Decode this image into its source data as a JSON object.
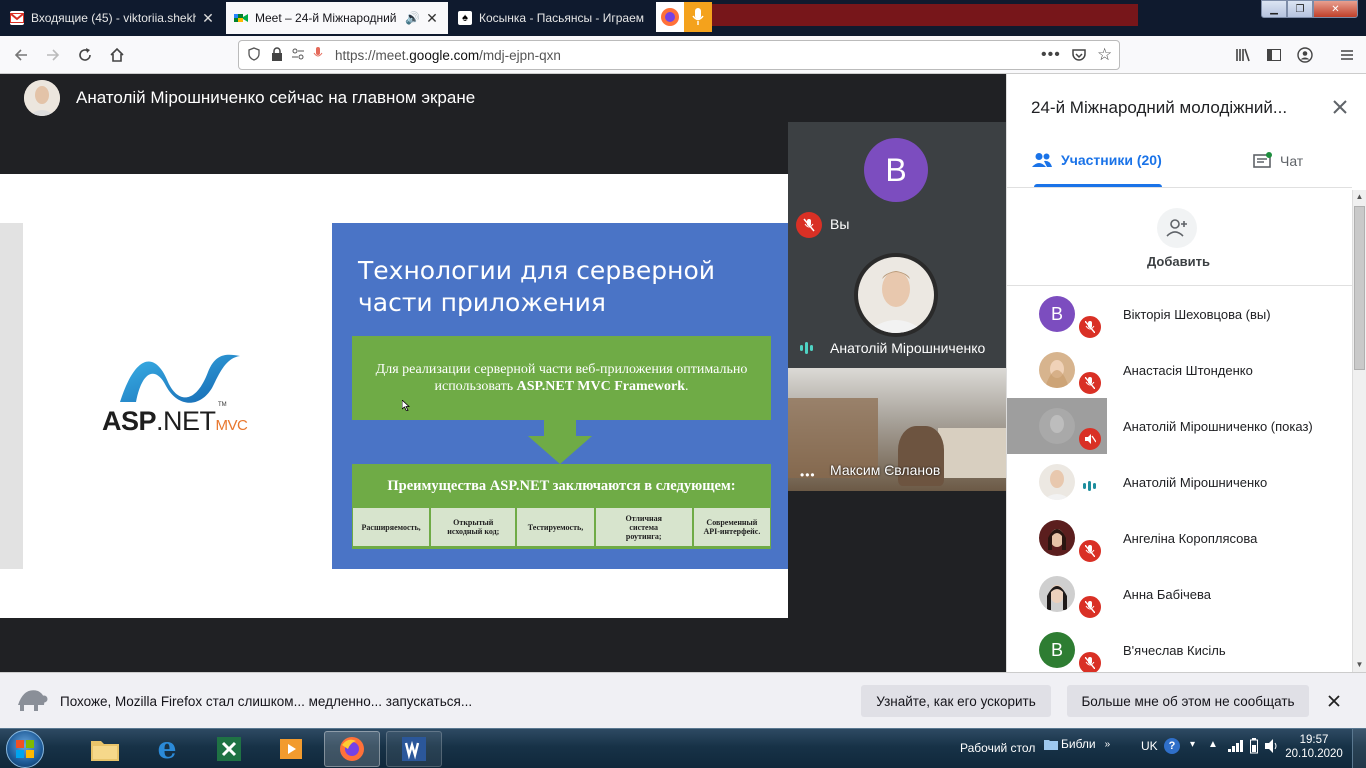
{
  "browser": {
    "tabs": [
      {
        "title": "Входящие (45) - viktoriia.shekh",
        "active": false,
        "favicon": "gmail-icon"
      },
      {
        "title": "Meet – 24-й Міжнародний",
        "active": true,
        "favicon": "meet-icon"
      },
      {
        "title": "Косынка - Пасьянсы - Играем",
        "active": false,
        "favicon": "cards-icon"
      }
    ],
    "url_prefix": "https://meet.",
    "url_domain": "google.com",
    "url_path": "/mdj-ejpn-qxn"
  },
  "meet": {
    "presenting_title": "Анатолій Мірошниченко сейчас на главном экране",
    "slide": {
      "title_line1": "Технологии для серверной",
      "title_line2": "части приложения",
      "box1_text": "Для реализации серверной части веб-приложения оптимально использовать",
      "box1_bold": "ASP.NET MVC Framework",
      "box1_end": ".",
      "box2_header": "Преимущества ASP.NET заключаются в следующем:",
      "cells": [
        "Расширяемость,",
        "Открытый исходный код;",
        "Тестируемость,",
        "Отличная система роутинга;",
        "Современный API-интерфейс."
      ],
      "logo_asp": "ASP",
      "logo_dotnet": ".NET",
      "logo_mvc": "MVC",
      "logo_tm": "TM"
    },
    "tiles": [
      {
        "label": "Вы",
        "avatar_letter": "B"
      },
      {
        "label": "Анатолій Мірошниченко"
      },
      {
        "label": "Максим Євланов"
      }
    ]
  },
  "panel": {
    "title": "24-й Міжнародний молодіжний...",
    "tab_participants": "Участники (20)",
    "tab_chat": "Чат",
    "add_label": "Добавить",
    "participants": [
      {
        "name": "Вікторія Шеховцова (вы)",
        "avatar": "B",
        "color": "#7c4dbf",
        "status": "muted"
      },
      {
        "name": "Анастасія Штонденко",
        "avatar": "",
        "color": "#c9a27a",
        "status": "muted"
      },
      {
        "name": "Анатолій Мірошниченко (показ)",
        "avatar": "",
        "color": "#9e9e9e",
        "status": "muted-presenting"
      },
      {
        "name": "Анатолій Мірошниченко",
        "avatar": "",
        "color": "#e0d6cc",
        "status": "speaking"
      },
      {
        "name": "Ангеліна Короплясова",
        "avatar": "",
        "color": "#6b2a2a",
        "status": "muted"
      },
      {
        "name": "Анна Бабічева",
        "avatar": "",
        "color": "#3b2f2f",
        "status": "muted"
      },
      {
        "name": "В'ячеслав Кисіль",
        "avatar": "B",
        "color": "#2e7d32",
        "status": "muted"
      }
    ]
  },
  "notification": {
    "text": "Похоже, Mozilla Firefox стал слишком... медленно... запускаться...",
    "btn_speedup": "Узнайте, как его ускорить",
    "btn_dismiss": "Больше мне об этом не сообщать"
  },
  "taskbar": {
    "desktop_label": "Рабочий стол",
    "folder_label": "Библи",
    "lang": "UK",
    "time": "19:57",
    "date": "20.10.2020"
  }
}
